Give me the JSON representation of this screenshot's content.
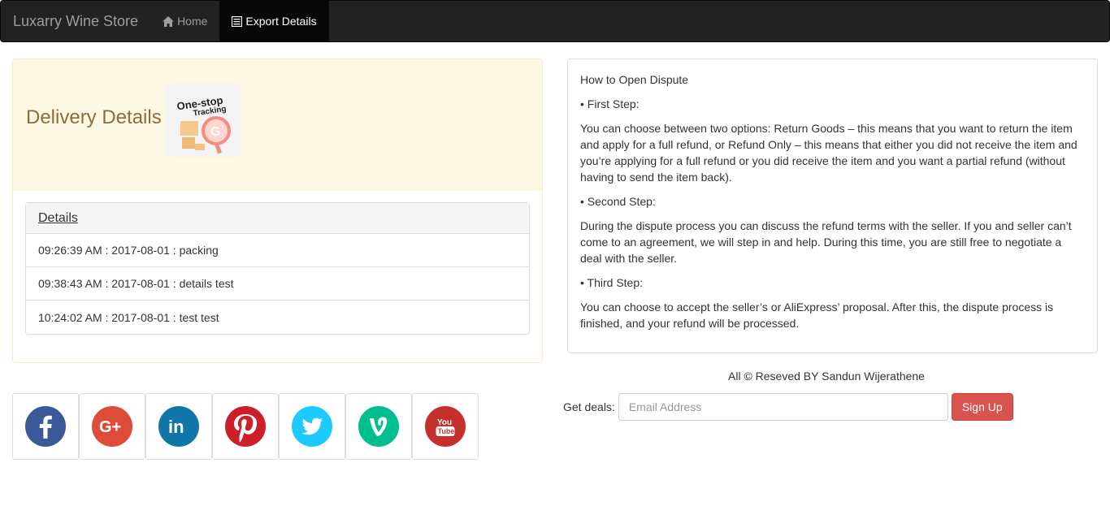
{
  "navbar": {
    "brand": "Luxarry Wine Store",
    "items": [
      {
        "label": "Home",
        "icon": "home-icon",
        "active": false
      },
      {
        "label": "Export Details",
        "icon": "list-icon",
        "active": true
      }
    ]
  },
  "delivery": {
    "title": "Delivery Details",
    "image": {
      "line1": "One-stop",
      "line2": "Tracking"
    },
    "details_header": "Details",
    "rows": [
      "09:26:39 AM : 2017-08-01 : packing",
      "09:38:43 AM : 2017-08-01 : details test",
      "10:24:02 AM : 2017-08-01 : test test"
    ]
  },
  "social": [
    {
      "name": "facebook-icon",
      "color": "#3b5998",
      "glyph": "f"
    },
    {
      "name": "google-plus-icon",
      "color": "#dd4b39",
      "glyph": "G+"
    },
    {
      "name": "linkedin-icon",
      "color": "#0e76a8",
      "glyph": "in"
    },
    {
      "name": "pinterest-icon",
      "color": "#cb2027",
      "glyph": "P"
    },
    {
      "name": "twitter-icon",
      "color": "#1dcaff",
      "glyph": "t"
    },
    {
      "name": "vine-icon",
      "color": "#00bf8f",
      "glyph": "V"
    },
    {
      "name": "youtube-icon",
      "color": "#c4302b",
      "glyph": "You Tube"
    }
  ],
  "dispute": {
    "paragraphs": [
      "How to Open Dispute",
      "• First Step:",
      "You can choose between two options: Return Goods – this means that you want to return the item and apply for a full refund, or Refund Only – this means that either you did not receive the item and you’re applying for a full refund or you did receive the item and you want a partial refund (without having to send the item back).",
      "• Second Step:",
      "During the dispute process you can discuss the refund terms with the seller. If you and seller can’t come to an agreement, we will step in and help. During this time, you are still free to negotiate a deal with the seller.",
      "• Third Step:",
      "You can choose to accept the seller’s or AliExpress’ proposal. After this, the dispute process is finished, and your refund will be processed."
    ]
  },
  "footer": {
    "copyright": "All © Reseved BY Sandun Wijerathene",
    "deals_label": "Get deals:",
    "email_placeholder": "Email Address",
    "signup_label": "Sign Up"
  }
}
